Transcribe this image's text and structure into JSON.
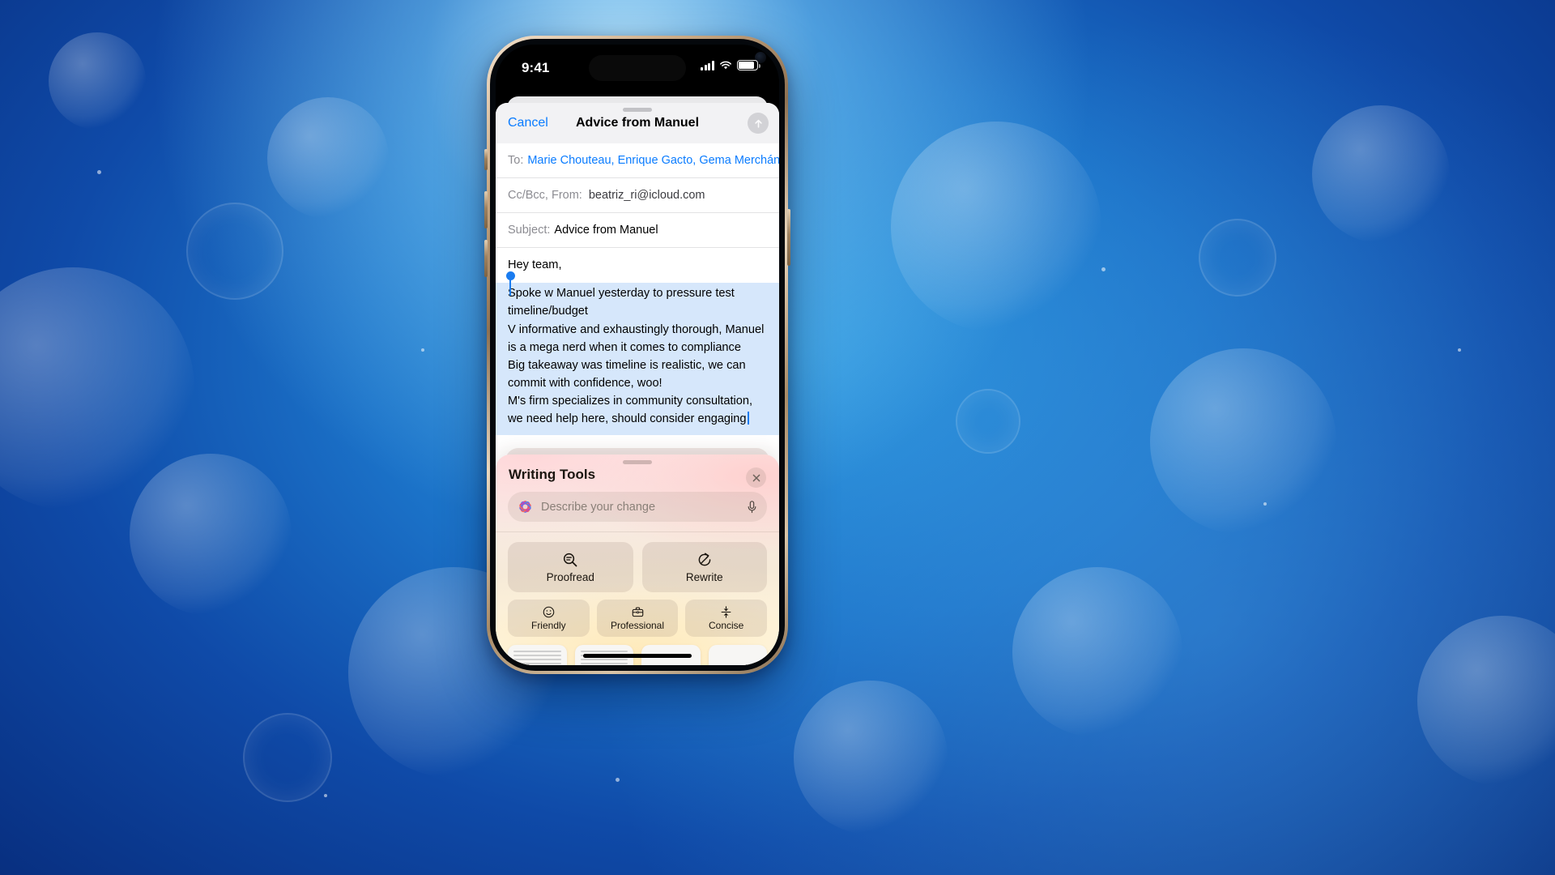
{
  "wallpaper": {
    "description": "blue underwater bokeh wallpaper",
    "base_color": "#1b72c8"
  },
  "device": {
    "name": "iPhone",
    "frame_color": "#c9a883"
  },
  "status_bar": {
    "time": "9:41",
    "signal_icon": "cellular-signal-icon",
    "wifi_icon": "wifi-icon",
    "battery_icon": "battery-icon",
    "dynamic_island": "dynamic-island",
    "camera_icon": "front-camera-icon"
  },
  "mail": {
    "navbar": {
      "cancel_label": "Cancel",
      "title": "Advice from Manuel",
      "send_icon": "send-arrow-up-icon"
    },
    "fields": {
      "to_label": "To:",
      "to_value": "Marie Chouteau, Enrique Gacto, Gema Merchán",
      "ccbcc_label": "Cc/Bcc, From:",
      "ccbcc_value": "beatriz_ri@icloud.com",
      "subject_label": "Subject:",
      "subject_value": "Advice from Manuel"
    },
    "body": {
      "greeting": "Hey team,",
      "selected_lines": [
        "Spoke w Manuel yesterday to pressure test timeline/budget",
        "V informative and exhaustingly thorough, Manuel is a mega nerd when it comes to compliance",
        "Big takeaway was timeline is realistic, we can commit with confidence, woo!",
        "M's firm specializes in community consultation, we need help here, should consider engaging"
      ],
      "selection_color": "#d6e7fb",
      "caret_color": "#1a7cf0"
    }
  },
  "writing_tools": {
    "title": "Writing Tools",
    "close_icon": "close-icon",
    "grabber_icon": "drag-grabber",
    "search": {
      "placeholder": "Describe your change",
      "leading_icon": "apple-intelligence-icon",
      "mic_icon": "microphone-icon"
    },
    "primary_actions": [
      {
        "label": "Proofread",
        "icon": "proofread-magnifier-icon"
      },
      {
        "label": "Rewrite",
        "icon": "rewrite-circle-arrow-icon"
      }
    ],
    "tone_actions": [
      {
        "label": "Friendly",
        "icon": "smiley-face-icon"
      },
      {
        "label": "Professional",
        "icon": "briefcase-icon"
      },
      {
        "label": "Concise",
        "icon": "compress-arrows-icon"
      }
    ],
    "format_actions": [
      {
        "icon": "summary-document-icon"
      },
      {
        "icon": "key-points-document-icon"
      },
      {
        "icon": "table-document-icon"
      },
      {
        "icon": "list-document-icon"
      }
    ]
  }
}
